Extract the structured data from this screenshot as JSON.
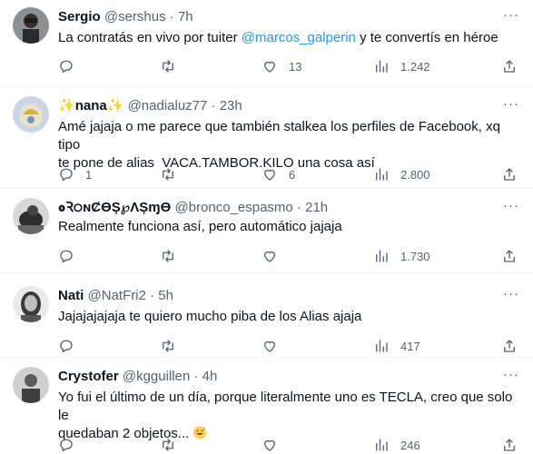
{
  "tweets": [
    {
      "name": "Sergio",
      "handle": "@sershus",
      "time": "7h",
      "text_before": "La contratás en vivo por tuiter ",
      "mention": "@marcos_galperin",
      "text_after": " y te convertís en héroe",
      "replies": "",
      "retweets": "",
      "likes": "13",
      "views": "1.242"
    },
    {
      "name_prefix": "✨",
      "name": "nana",
      "name_suffix": "✨",
      "handle": "@nadialuz77",
      "time": "23h",
      "text_line1": "Amé jajaja o me parece que también stalkea los perfiles de Facebook, xq tipo",
      "text_line2": "te pone de alias  VACA.TAMBOR.KILO una cosa así",
      "replies": "1",
      "retweets": "",
      "likes": "6",
      "views": "2.800"
    },
    {
      "name": "ߋꝚ੦ɴȻϴȘ℘ɅȘɱϴ",
      "handle": "@bronco_espasmo",
      "time": "21h",
      "text": "Realmente funciona así, pero automático jajaja",
      "replies": "",
      "retweets": "",
      "likes": "",
      "views": "1.730"
    },
    {
      "name": "Nati",
      "handle": "@NatFri2",
      "time": "5h",
      "text": "Jajajajajaja te quiero mucho piba de los Alias ajaja",
      "replies": "",
      "retweets": "",
      "likes": "",
      "views": "417"
    },
    {
      "name": "Crystofer",
      "handle": "@kgguillen",
      "time": "4h",
      "text_line1": "Yo fui el último de un día, porque literalmente uno es TECLA, creo que solo le",
      "text_line2": "quedaban 2 objetos...",
      "replies": "",
      "retweets": "",
      "likes": "",
      "views": "246"
    }
  ],
  "separator": "·",
  "icons": [
    "reply-icon",
    "retweet-icon",
    "like-icon",
    "views-icon",
    "share-icon",
    "more-icon"
  ],
  "colors": {
    "accent": "#1d9bf0",
    "secondary_text": "#536471",
    "text": "#0f1419"
  }
}
